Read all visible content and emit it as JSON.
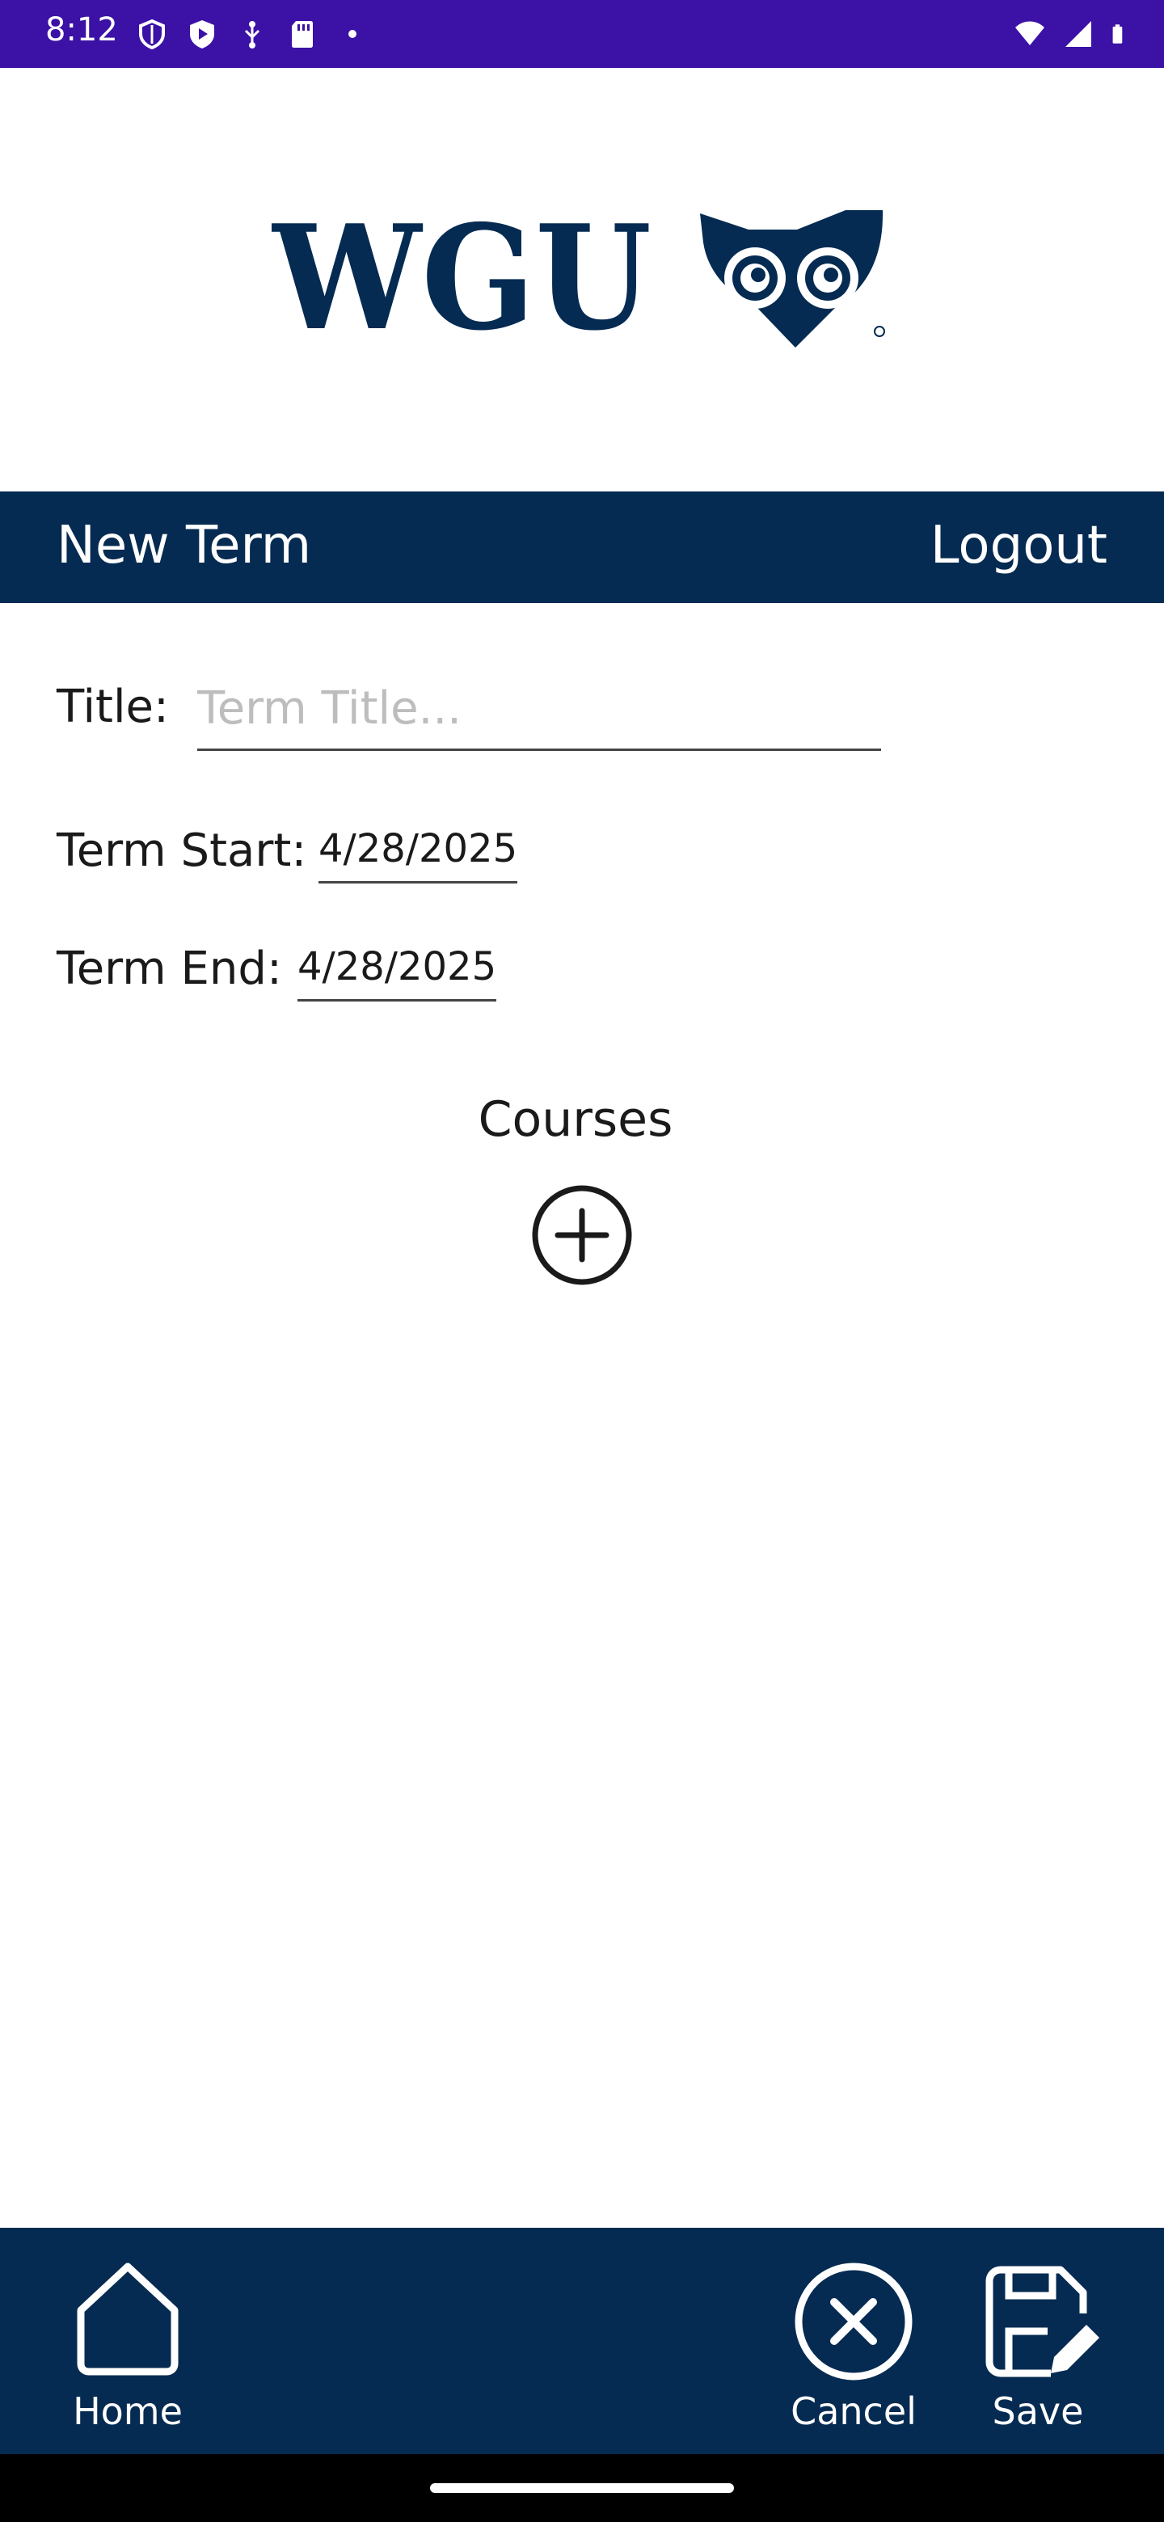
{
  "status_bar": {
    "time": "8:12",
    "left_icons": [
      "shield-icon",
      "play-protect-icon",
      "usb-debug-icon",
      "sd-card-icon",
      "dot-icon"
    ],
    "right_icons": [
      "wifi-icon",
      "signal-icon",
      "battery-icon"
    ]
  },
  "logo": {
    "text": "WGU",
    "brand_color": "#062b52"
  },
  "header": {
    "title": "New Term",
    "logout_label": "Logout",
    "background": "#062b52"
  },
  "form": {
    "title_label": "Title:",
    "title_value": "",
    "title_placeholder": "Term Title...",
    "start_label": "Term Start:",
    "start_value": "4/28/2025",
    "end_label": "Term End:",
    "end_value": "4/28/2025"
  },
  "courses": {
    "heading": "Courses",
    "add_icon": "plus-circle-icon"
  },
  "bottom_nav": {
    "home_label": "Home",
    "cancel_label": "Cancel",
    "save_label": "Save"
  }
}
